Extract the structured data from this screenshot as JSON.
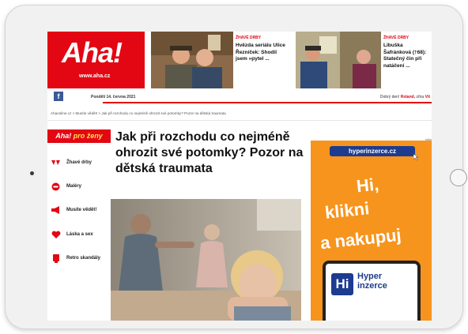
{
  "header": {
    "logo_text": "Aha!",
    "logo_url": "www.aha.cz",
    "date": "Pondělí 14. června 2021",
    "welcome_prefix": "Dobrý den!",
    "welcome_name": "Roland,",
    "welcome_suffix": "zítra",
    "welcome_highlight": "Vít"
  },
  "promos": [
    {
      "tag": "ŽHAVÉ DRBY",
      "text": "Hvězda seriálu Ulice Řezníček: Shodil jsem »pytel ..."
    },
    {
      "tag": "ŽHAVÉ DRBY",
      "text": "Libuška Šafránková (†68): Statečný čin při natáčení ..."
    }
  ],
  "breadcrumb": "Ahaonline.cz  >  Musíte vědět!  >  Jak při rozchodu co nejméně ohrozit své potomky? Pozor na dětská traumata",
  "sidebar": {
    "section_prefix": "Aha!",
    "section_suffix": "pro ženy",
    "items": [
      {
        "label": "Žhavé drby",
        "icon": "glasses-icon"
      },
      {
        "label": "Maléry",
        "icon": "alert-icon"
      },
      {
        "label": "Musíte vědět!",
        "icon": "megaphone-icon"
      },
      {
        "label": "Láska a sex",
        "icon": "heart-icon"
      },
      {
        "label": "Retro skandály",
        "icon": "retro-icon"
      }
    ]
  },
  "article": {
    "headline": "Jak při rozchodu co nejméně ohrozit své potomky? Pozor na dětská traumata"
  },
  "ad": {
    "label": "reklama",
    "pill": "hyperinzerce.cz",
    "line1": "Hi,",
    "line2": "klikni",
    "line3": "a nakupuj",
    "logo_mark": "Hi",
    "logo_word1": "Hyper",
    "logo_word2": "inzerce"
  },
  "colors": {
    "brand_red": "#e30613",
    "ad_orange": "#f7941d",
    "ad_blue": "#1d3b8f"
  }
}
